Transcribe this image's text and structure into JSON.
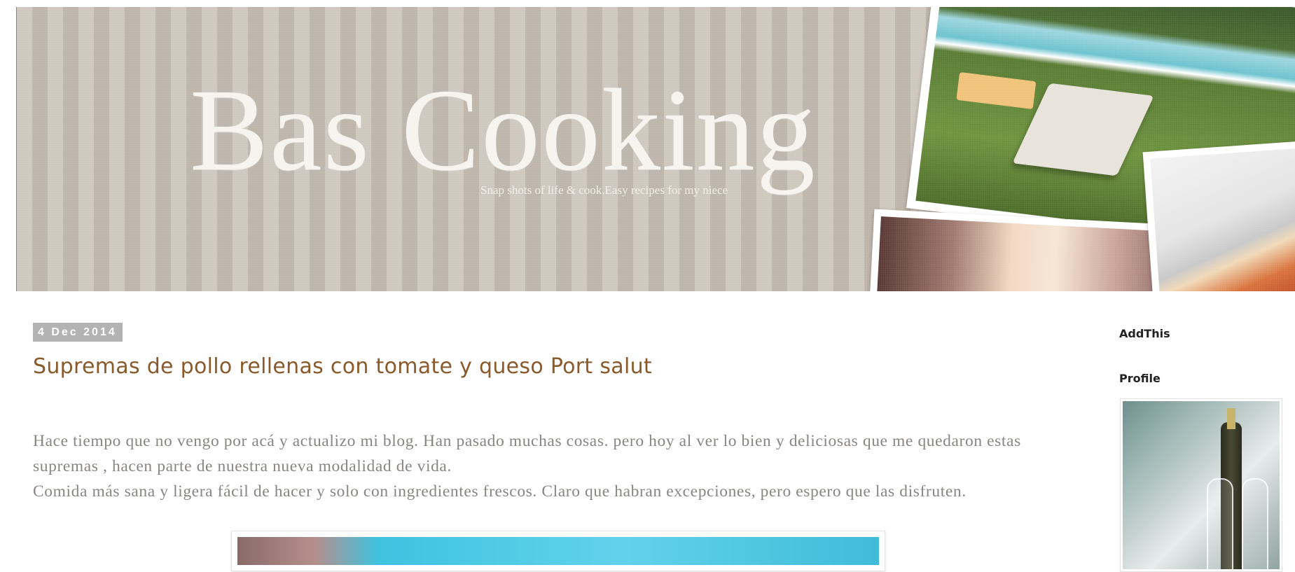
{
  "header": {
    "title": "Bas Cooking",
    "tagline": "Snap shots of life & cook.Easy recipes for my niece"
  },
  "post": {
    "date": "4 Dec 2014",
    "title": "Supremas de pollo rellenas con tomate y queso Port salut",
    "paragraphs": [
      "Hace tiempo que no vengo por acá y actualizo mi blog. Han pasado muchas cosas. pero hoy al ver lo bien y deliciosas que me quedaron estas supremas , hacen parte de nuestra nueva modalidad de vida.",
      "Comida más sana y ligera fácil de hacer y solo con ingredientes frescos. Claro que habran excepciones, pero espero que las disfruten."
    ]
  },
  "sidebar": {
    "addthis_heading": "AddThis",
    "profile_heading": "Profile"
  },
  "colors": {
    "title_brown": "#8a5a2b",
    "body_gray": "#8a8583",
    "date_badge_bg": "#b3b3b3"
  }
}
